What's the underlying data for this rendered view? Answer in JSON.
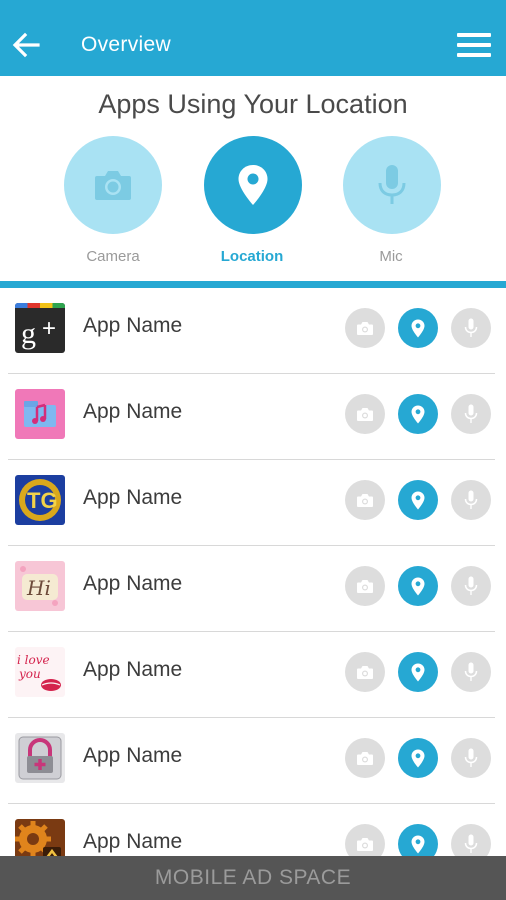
{
  "topbar": {
    "title": "Overview",
    "back_icon": "arrow-left-icon",
    "menu_icon": "hamburger-menu-icon"
  },
  "heading": "Apps Using Your Location",
  "permissions": [
    {
      "label": "Camera",
      "icon": "camera-icon",
      "selected": false
    },
    {
      "label": "Location",
      "icon": "map-pin-icon",
      "selected": true
    },
    {
      "label": "Mic",
      "icon": "microphone-icon",
      "selected": false
    }
  ],
  "apps": [
    {
      "name": "App Name",
      "icon": "google-plus-app-icon",
      "location_on": true
    },
    {
      "name": "App Name",
      "icon": "music-folder-app-icon",
      "location_on": true
    },
    {
      "name": "App Name",
      "icon": "tg-badge-app-icon",
      "location_on": true
    },
    {
      "name": "App Name",
      "icon": "hi-note-app-icon",
      "location_on": true
    },
    {
      "name": "App Name",
      "icon": "i-love-you-app-icon",
      "location_on": true
    },
    {
      "name": "App Name",
      "icon": "lock-plus-app-icon",
      "location_on": true
    },
    {
      "name": "App Name",
      "icon": "gear-app-icon",
      "location_on": true
    }
  ],
  "ad": {
    "text": "MOBILE AD SPACE"
  },
  "colors": {
    "accent": "#26a8d3",
    "accent_light": "#a9e2f3",
    "inactive_button": "#dddddd",
    "ad_bar": "#555555"
  }
}
